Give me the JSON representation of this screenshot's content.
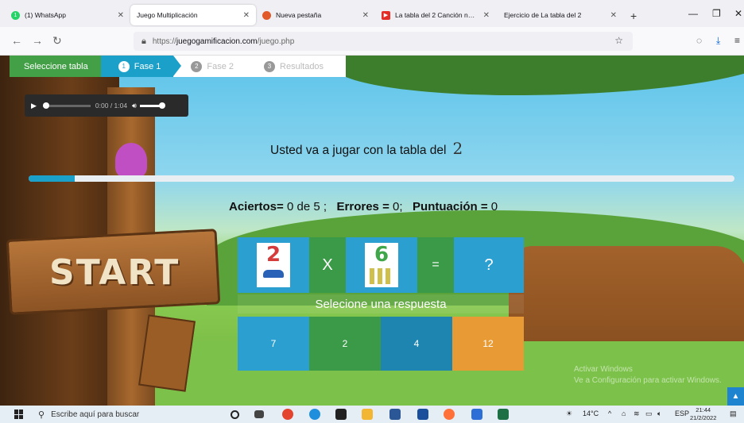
{
  "browser": {
    "tabs": [
      {
        "label": "(1) WhatsApp",
        "favicon_color": "#25d366",
        "favicon_text": "1",
        "active": false
      },
      {
        "label": "Juego Multiplicación",
        "favicon_color": "",
        "favicon_text": "",
        "active": true
      },
      {
        "label": "Nueva pestaña",
        "favicon_color": "#e05a2a",
        "favicon_text": "",
        "active": false
      },
      {
        "label": "La tabla del 2 Canción nueva, Ta",
        "favicon_color": "#e52d27",
        "favicon_text": "▶",
        "active": false
      },
      {
        "label": "Ejercicio de La tabla del 2",
        "favicon_color": "",
        "favicon_text": "",
        "active": false
      }
    ],
    "new_tab": "+",
    "window_controls": [
      "—",
      "❐",
      "✕"
    ],
    "url_prefix": "https://",
    "url_domain": "juegogamificacion.com",
    "url_path": "/juego.php"
  },
  "steps": {
    "select": "Seleccione tabla",
    "items": [
      {
        "num": "1",
        "label": "Fase 1",
        "active": true
      },
      {
        "num": "2",
        "label": "Fase 2",
        "active": false
      },
      {
        "num": "3",
        "label": "Resultados",
        "active": false
      }
    ]
  },
  "audio": {
    "time": "0:00 / 1:04",
    "progress": 0
  },
  "intro": {
    "text": "Usted va a jugar con la tabla del",
    "table": "2"
  },
  "progress_fraction": 0.065,
  "score": {
    "aciertos_label": "Aciertos=",
    "aciertos_value": "0 de 5 ;",
    "errores_label": "Errores =",
    "errores_value": "0;",
    "puntuacion_label": "Puntuación =",
    "puntuacion_value": "0"
  },
  "question": {
    "a": "2",
    "op": "X",
    "b": "6",
    "eq": "=",
    "result": "?"
  },
  "prompt": "Selecione una respuesta",
  "answers": [
    "7",
    "2",
    "4",
    "12"
  ],
  "scene": {
    "sign": "START"
  },
  "watermark": {
    "line1": "Activar Windows",
    "line2": "Ve a Configuración para activar Windows."
  },
  "taskbar": {
    "search_placeholder": "Escribe aquí para buscar",
    "temperature": "14°C",
    "language": "ESP",
    "time": "21:44",
    "date": "21/2/2022"
  }
}
